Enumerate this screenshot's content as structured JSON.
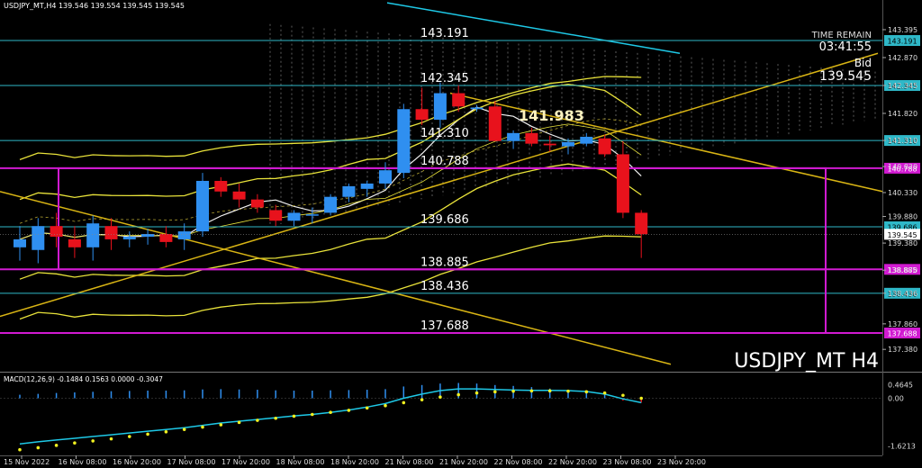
{
  "header": {
    "symbol_line": "USDJPY_MT,H4 139.546 139.554 139.545 139.545"
  },
  "info": {
    "time_remain_label": "TIME REMAIN",
    "time_remain_value": "03:41:55",
    "bid_label": "Bid",
    "bid_value": "139.545"
  },
  "watermark": "USDJPY_MT H4",
  "highlight_price": "141.983",
  "colors": {
    "background": "#000000",
    "bull": "#2f8ff0",
    "bear": "#e8121c",
    "bollinger": "#e8e23a",
    "level_line": "#2fb8c8",
    "magenta": "#d11ad1",
    "trend": "#d8b414",
    "ichimoku": "#9a9a9a",
    "macd_line": "#1ec8e6",
    "macd_signal": "#f0f020",
    "current_price": "#ffffff"
  },
  "chart_data": {
    "type": "candlestick",
    "symbol": "USDJPY_MT",
    "timeframe": "H4",
    "ylim": [
      137.18,
      143.75
    ],
    "price_ticks": [
      "143.395",
      "142.870",
      "142.345",
      "141.820",
      "141.310",
      "140.820",
      "140.330",
      "139.880",
      "139.380",
      "138.870",
      "138.436",
      "137.860",
      "137.380"
    ],
    "horizontal_levels": [
      {
        "price": 143.191,
        "label": "143.191",
        "axis_label": "143.191",
        "color": "level_line"
      },
      {
        "price": 142.345,
        "label": "142.345",
        "axis_label": "142.345",
        "color": "level_line"
      },
      {
        "price": 141.31,
        "label": "141.310",
        "axis_label": "141.310",
        "color": "level_line"
      },
      {
        "price": 140.788,
        "label": "140.788",
        "axis_label": "140.788",
        "color": "magenta"
      },
      {
        "price": 139.686,
        "label": "139.686",
        "axis_label": "139.686",
        "color": "level_line"
      },
      {
        "price": 138.885,
        "label": "138.885",
        "axis_label": "138.885",
        "color": "magenta"
      },
      {
        "price": 138.436,
        "label": "138.436",
        "axis_label": "138.436",
        "color": "level_line"
      },
      {
        "price": 137.688,
        "label": "137.688",
        "axis_label": "137.688",
        "color": "magenta"
      }
    ],
    "current_price": 139.545,
    "current_price_label": "139.545",
    "x_labels": [
      "15 Nov 2022",
      "16 Nov 08:00",
      "16 Nov 20:00",
      "17 Nov 08:00",
      "17 Nov 20:00",
      "18 Nov 08:00",
      "18 Nov 20:00",
      "21 Nov 08:00",
      "21 Nov 20:00",
      "22 Nov 08:00",
      "22 Nov 20:00",
      "23 Nov 08:00",
      "23 Nov 20:00"
    ],
    "candles": [
      {
        "o": 139.3,
        "h": 139.7,
        "l": 139.05,
        "c": 139.45
      },
      {
        "o": 139.25,
        "h": 139.85,
        "l": 139.0,
        "c": 139.7
      },
      {
        "o": 139.7,
        "h": 139.95,
        "l": 139.3,
        "c": 139.5
      },
      {
        "o": 139.45,
        "h": 139.7,
        "l": 139.1,
        "c": 139.3
      },
      {
        "o": 139.3,
        "h": 139.9,
        "l": 139.05,
        "c": 139.75
      },
      {
        "o": 139.7,
        "h": 139.85,
        "l": 139.25,
        "c": 139.45
      },
      {
        "o": 139.45,
        "h": 139.6,
        "l": 139.3,
        "c": 139.5
      },
      {
        "o": 139.5,
        "h": 139.65,
        "l": 139.35,
        "c": 139.55
      },
      {
        "o": 139.55,
        "h": 139.7,
        "l": 139.3,
        "c": 139.4
      },
      {
        "o": 139.45,
        "h": 139.75,
        "l": 139.25,
        "c": 139.6
      },
      {
        "o": 139.6,
        "h": 140.7,
        "l": 139.5,
        "c": 140.55
      },
      {
        "o": 140.55,
        "h": 140.62,
        "l": 140.25,
        "c": 140.35
      },
      {
        "o": 140.35,
        "h": 140.5,
        "l": 140.05,
        "c": 140.2
      },
      {
        "o": 140.2,
        "h": 140.3,
        "l": 139.95,
        "c": 140.05
      },
      {
        "o": 140.0,
        "h": 140.1,
        "l": 139.7,
        "c": 139.8
      },
      {
        "o": 139.8,
        "h": 140.0,
        "l": 139.7,
        "c": 139.95
      },
      {
        "o": 139.9,
        "h": 140.05,
        "l": 139.75,
        "c": 139.92
      },
      {
        "o": 139.95,
        "h": 140.3,
        "l": 139.9,
        "c": 140.25
      },
      {
        "o": 140.25,
        "h": 140.5,
        "l": 140.15,
        "c": 140.45
      },
      {
        "o": 140.4,
        "h": 140.55,
        "l": 140.25,
        "c": 140.5
      },
      {
        "o": 140.5,
        "h": 140.9,
        "l": 140.4,
        "c": 140.75
      },
      {
        "o": 140.7,
        "h": 142.0,
        "l": 140.6,
        "c": 141.9
      },
      {
        "o": 141.9,
        "h": 142.3,
        "l": 141.6,
        "c": 141.7
      },
      {
        "o": 141.7,
        "h": 142.4,
        "l": 141.55,
        "c": 142.2
      },
      {
        "o": 142.2,
        "h": 142.35,
        "l": 141.85,
        "c": 141.95
      },
      {
        "o": 141.9,
        "h": 141.98,
        "l": 141.85,
        "c": 141.93
      },
      {
        "o": 141.95,
        "h": 142.05,
        "l": 141.3,
        "c": 141.3
      },
      {
        "o": 141.3,
        "h": 141.5,
        "l": 141.15,
        "c": 141.45
      },
      {
        "o": 141.45,
        "h": 141.55,
        "l": 141.2,
        "c": 141.25
      },
      {
        "o": 141.25,
        "h": 141.4,
        "l": 141.1,
        "c": 141.22
      },
      {
        "o": 141.2,
        "h": 141.35,
        "l": 141.05,
        "c": 141.28
      },
      {
        "o": 141.25,
        "h": 141.45,
        "l": 141.2,
        "c": 141.38
      },
      {
        "o": 141.35,
        "h": 141.42,
        "l": 141.0,
        "c": 141.05
      },
      {
        "o": 141.05,
        "h": 141.3,
        "l": 139.85,
        "c": 139.95
      },
      {
        "o": 139.95,
        "h": 140.0,
        "l": 139.1,
        "c": 139.545
      }
    ],
    "macd": {
      "label": "MACD(12,26,9) -0.1484 0.1563 0.0000 -0.3047",
      "ticks": [
        "0.4645",
        "0.00",
        "-1.6213"
      ],
      "ylim": [
        -1.85,
        0.75
      ],
      "histogram": [
        0.12,
        0.15,
        0.18,
        0.2,
        0.22,
        0.24,
        0.25,
        0.26,
        0.26,
        0.27,
        0.3,
        0.31,
        0.3,
        0.29,
        0.27,
        0.26,
        0.26,
        0.27,
        0.28,
        0.29,
        0.31,
        0.4,
        0.45,
        0.5,
        0.52,
        0.5,
        0.45,
        0.42,
        0.38,
        0.33,
        0.28,
        0.22,
        0.12,
        -0.08,
        -0.15
      ],
      "main": [
        -1.55,
        -1.48,
        -1.42,
        -1.36,
        -1.3,
        -1.24,
        -1.18,
        -1.12,
        -1.06,
        -1.0,
        -0.92,
        -0.84,
        -0.78,
        -0.72,
        -0.66,
        -0.6,
        -0.55,
        -0.48,
        -0.4,
        -0.3,
        -0.18,
        0.0,
        0.14,
        0.26,
        0.32,
        0.32,
        0.3,
        0.28,
        0.27,
        0.27,
        0.26,
        0.23,
        0.14,
        -0.02,
        -0.15
      ],
      "signal": [
        -1.75,
        -1.68,
        -1.6,
        -1.52,
        -1.45,
        -1.38,
        -1.3,
        -1.22,
        -1.14,
        -1.06,
        -0.98,
        -0.9,
        -0.82,
        -0.75,
        -0.68,
        -0.61,
        -0.55,
        -0.48,
        -0.41,
        -0.33,
        -0.25,
        -0.15,
        -0.05,
        0.04,
        0.12,
        0.18,
        0.22,
        0.24,
        0.25,
        0.25,
        0.24,
        0.22,
        0.18,
        0.1,
        0.0
      ]
    }
  }
}
